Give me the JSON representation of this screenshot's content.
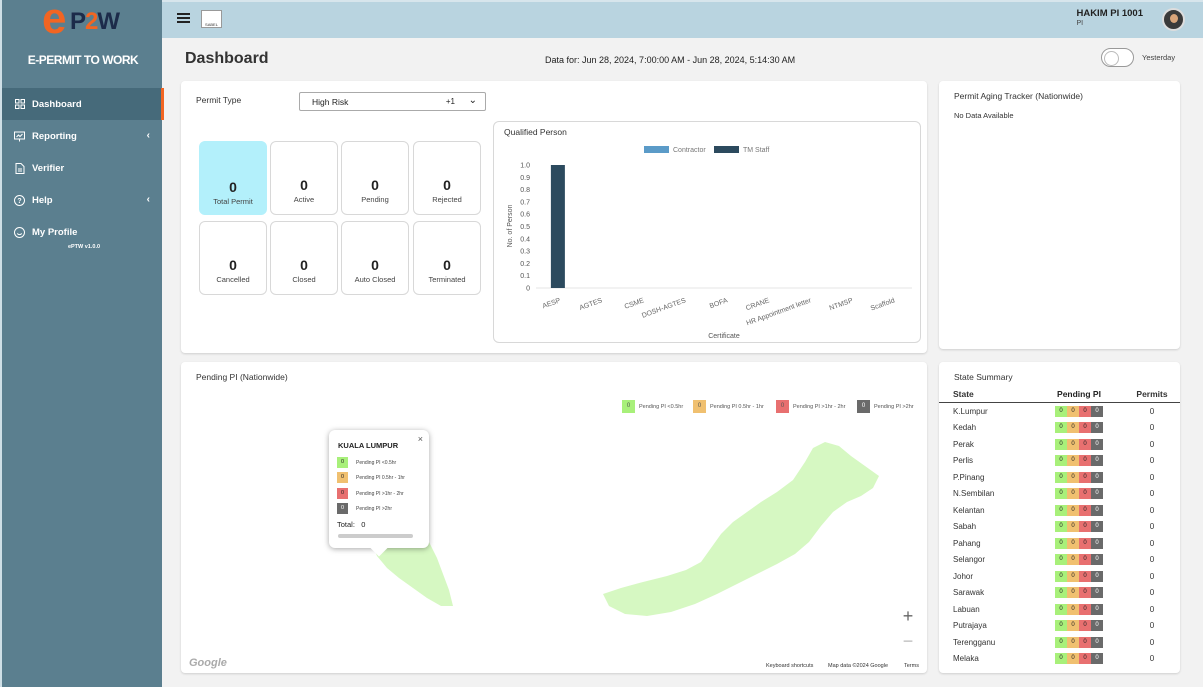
{
  "sidebar": {
    "logo_e": "e",
    "logo_rest_1": "P",
    "logo_rest_2": "2",
    "logo_rest_3": "W",
    "brand": "E-PERMIT TO WORK",
    "items": [
      {
        "label": "Dashboard",
        "icon": "grid-icon"
      },
      {
        "label": "Reporting",
        "icon": "presentation-icon",
        "chevron": "‹"
      },
      {
        "label": "Verifier",
        "icon": "document-icon"
      },
      {
        "label": "Help",
        "icon": "question-icon",
        "chevron": "‹"
      },
      {
        "label": "My Profile",
        "icon": "smiley-icon"
      }
    ],
    "version": "ePTW v1.0.0"
  },
  "topbar": {
    "logo_text": "SABEL",
    "user_name": "HAKIM PI 1001",
    "user_role": "PI"
  },
  "header": {
    "title": "Dashboard",
    "data_for": "Data for: Jun 28, 2024, 7:00:00 AM - Jun 28, 2024, 5:14:30 AM",
    "toggle_label": "Yesterday",
    "toggle_on": false
  },
  "permit": {
    "type_label": "Permit Type",
    "selected": "High Risk",
    "extra": "+1",
    "tiles": [
      {
        "value": "0",
        "label": "Total Permit"
      },
      {
        "value": "0",
        "label": "Active"
      },
      {
        "value": "0",
        "label": "Pending"
      },
      {
        "value": "0",
        "label": "Rejected"
      },
      {
        "value": "0",
        "label": "Cancelled"
      },
      {
        "value": "0",
        "label": "Closed"
      },
      {
        "value": "0",
        "label": "Auto Closed"
      },
      {
        "value": "0",
        "label": "Terminated"
      }
    ]
  },
  "chart_data": {
    "type": "bar",
    "title": "Qualified Person",
    "xlabel": "Certificate",
    "ylabel": "No. of Person",
    "ylim": [
      0,
      1.0
    ],
    "yticks": [
      "1.0",
      "0.9",
      "0.8",
      "0.7",
      "0.6",
      "0.5",
      "0.4",
      "0.3",
      "0.2",
      "0.1",
      "0"
    ],
    "categories": [
      "AESP",
      "AGTES",
      "CSME",
      "DOSH-AGTES",
      "BOFA",
      "CRANE",
      "HR Appointment letter",
      "NTMSP",
      "Scaffold"
    ],
    "series": [
      {
        "name": "Contractor",
        "color": "#5b9bc8",
        "values": [
          0,
          0,
          0,
          0,
          0,
          0,
          0,
          0,
          0
        ]
      },
      {
        "name": "TM Staff",
        "color": "#2c4a5e",
        "values": [
          1,
          0,
          0,
          0,
          0,
          0,
          0,
          0,
          0
        ]
      }
    ],
    "legend": "top"
  },
  "aging": {
    "title": "Permit Aging Tracker (Nationwide)",
    "empty": "No Data Available"
  },
  "map": {
    "title": "Pending PI (Nationwide)",
    "legend": [
      {
        "value": "0",
        "label": "Pending PI <0.5hr",
        "color": "#a8f07a"
      },
      {
        "value": "0",
        "label": "Pending PI 0.5hr - 1hr",
        "color": "#f0c070"
      },
      {
        "value": "0",
        "label": "Pending PI >1hr - 2hr",
        "color": "#e87070"
      },
      {
        "value": "0",
        "label": "Pending PI >2hr",
        "color": "#6a6a6a"
      }
    ],
    "popup": {
      "title": "KUALA LUMPUR",
      "close": "×",
      "rows": [
        {
          "value": "0",
          "label": "Pending PI <0.5hr"
        },
        {
          "value": "0",
          "label": "Pending PI 0.5hr - 1hr"
        },
        {
          "value": "0",
          "label": "Pending PI >1hr - 2hr"
        },
        {
          "value": "0",
          "label": "Pending PI >2hr"
        }
      ],
      "total_label": "Total:",
      "total_value": "0"
    },
    "zoom_in": "+",
    "zoom_out": "−",
    "google": "Google",
    "footer": [
      "Keyboard shortcuts",
      "Map data ©2024 Google",
      "Terms"
    ]
  },
  "state_summary": {
    "title": "State Summary",
    "headers": [
      "State",
      "Pending PI",
      "Permits"
    ],
    "rows": [
      {
        "state": "K.Lumpur",
        "p": [
          "0",
          "0",
          "0",
          "0"
        ],
        "permits": "0"
      },
      {
        "state": "Kedah",
        "p": [
          "0",
          "0",
          "0",
          "0"
        ],
        "permits": "0"
      },
      {
        "state": "Perak",
        "p": [
          "0",
          "0",
          "0",
          "0"
        ],
        "permits": "0"
      },
      {
        "state": "Perlis",
        "p": [
          "0",
          "0",
          "0",
          "0"
        ],
        "permits": "0"
      },
      {
        "state": "P.Pinang",
        "p": [
          "0",
          "0",
          "0",
          "0"
        ],
        "permits": "0"
      },
      {
        "state": "N.Sembilan",
        "p": [
          "0",
          "0",
          "0",
          "0"
        ],
        "permits": "0"
      },
      {
        "state": "Kelantan",
        "p": [
          "0",
          "0",
          "0",
          "0"
        ],
        "permits": "0"
      },
      {
        "state": "Sabah",
        "p": [
          "0",
          "0",
          "0",
          "0"
        ],
        "permits": "0"
      },
      {
        "state": "Pahang",
        "p": [
          "0",
          "0",
          "0",
          "0"
        ],
        "permits": "0"
      },
      {
        "state": "Selangor",
        "p": [
          "0",
          "0",
          "0",
          "0"
        ],
        "permits": "0"
      },
      {
        "state": "Johor",
        "p": [
          "0",
          "0",
          "0",
          "0"
        ],
        "permits": "0"
      },
      {
        "state": "Sarawak",
        "p": [
          "0",
          "0",
          "0",
          "0"
        ],
        "permits": "0"
      },
      {
        "state": "Labuan",
        "p": [
          "0",
          "0",
          "0",
          "0"
        ],
        "permits": "0"
      },
      {
        "state": "Putrajaya",
        "p": [
          "0",
          "0",
          "0",
          "0"
        ],
        "permits": "0"
      },
      {
        "state": "Terengganu",
        "p": [
          "0",
          "0",
          "0",
          "0"
        ],
        "permits": "0"
      },
      {
        "state": "Melaka",
        "p": [
          "0",
          "0",
          "0",
          "0"
        ],
        "permits": "0"
      }
    ]
  }
}
